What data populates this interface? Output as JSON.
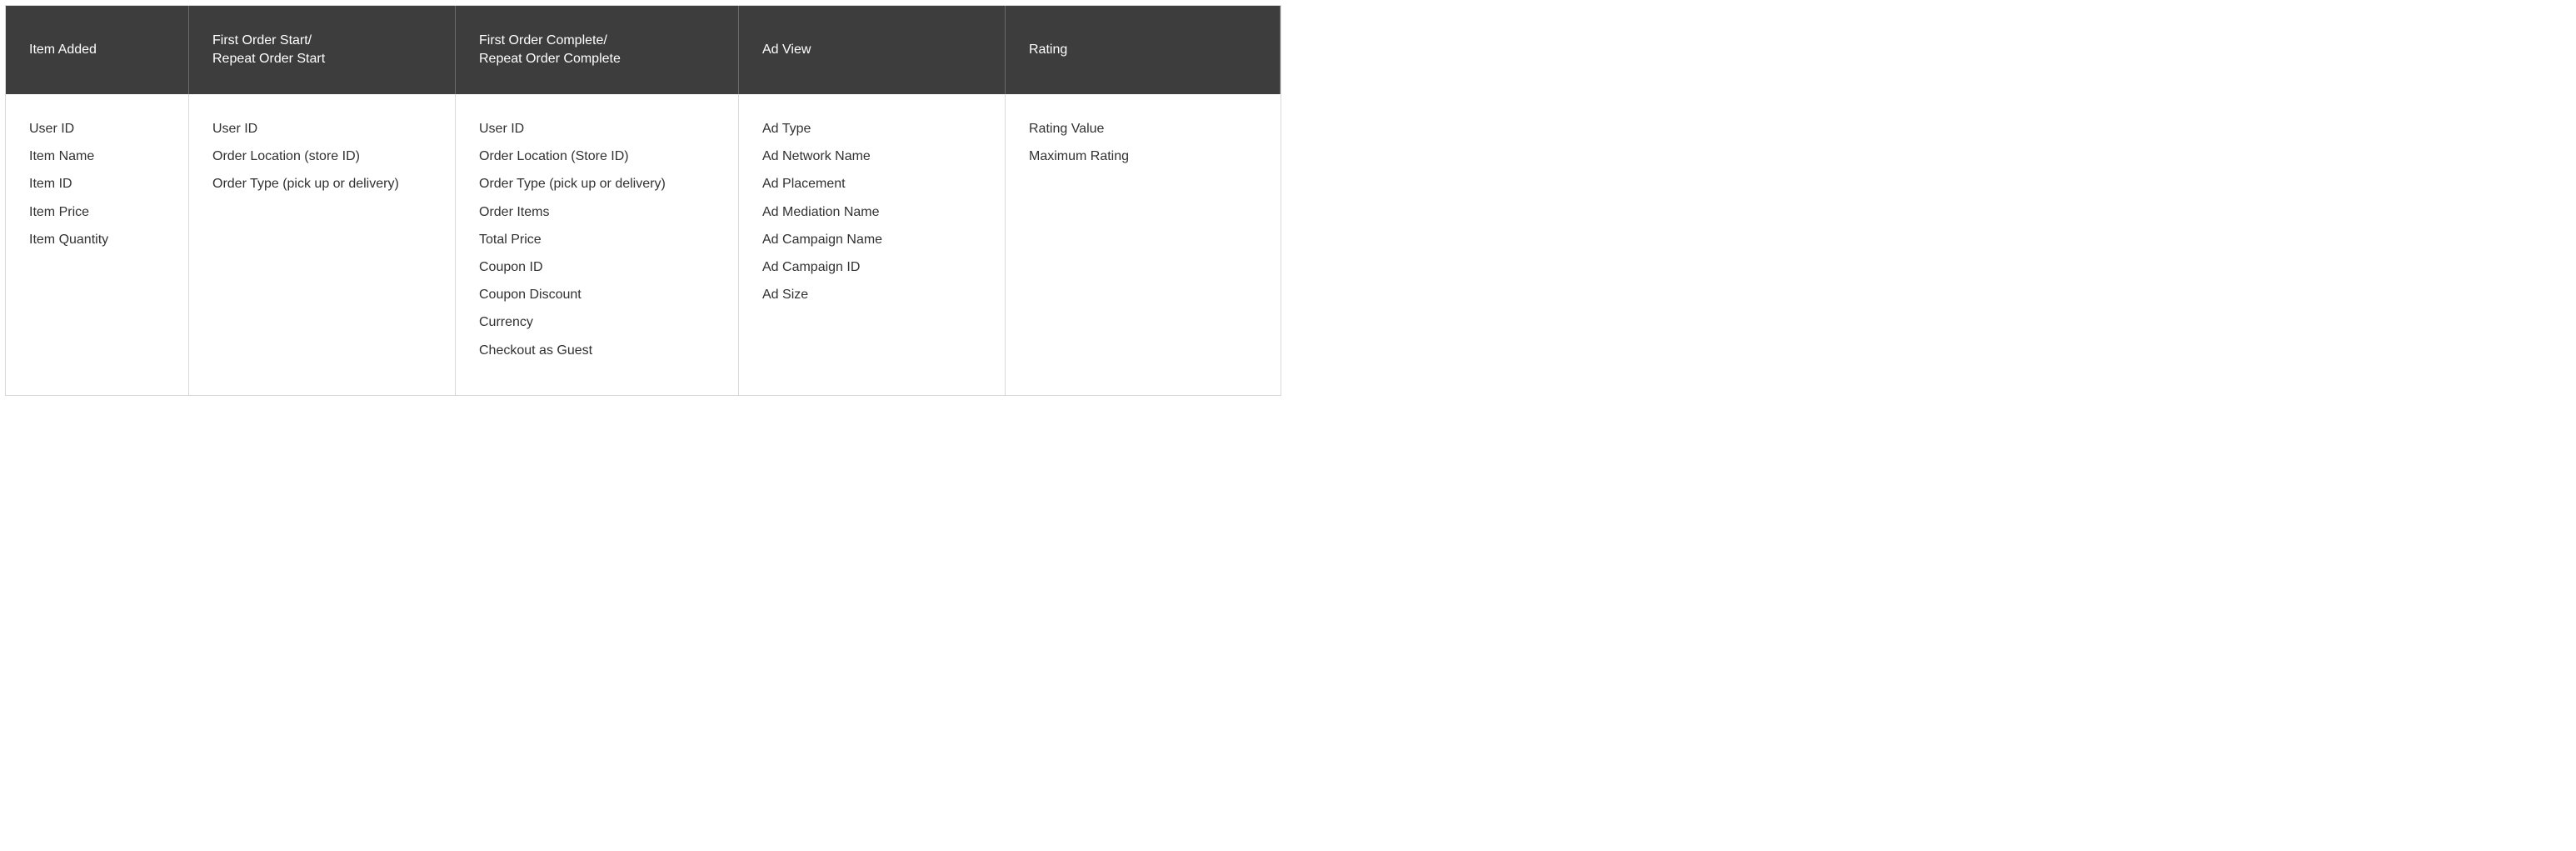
{
  "columns": [
    {
      "header_lines": [
        "Item Added"
      ],
      "items": [
        "User ID",
        "Item Name",
        "Item ID",
        "Item Price",
        "Item Quantity"
      ]
    },
    {
      "header_lines": [
        "First Order Start/",
        "Repeat Order Start"
      ],
      "items": [
        "User ID",
        "Order Location (store ID)",
        "Order Type (pick up or delivery)"
      ]
    },
    {
      "header_lines": [
        "First Order Complete/",
        "Repeat Order Complete"
      ],
      "items": [
        "User ID",
        "Order Location (Store ID)",
        "Order Type (pick up or delivery)",
        "Order Items",
        "Total Price",
        "Coupon ID",
        "Coupon Discount",
        "Currency",
        "Checkout as Guest"
      ]
    },
    {
      "header_lines": [
        "Ad View"
      ],
      "items": [
        "Ad Type",
        "Ad Network Name",
        "Ad Placement",
        "Ad Mediation Name",
        "Ad Campaign Name",
        "Ad Campaign ID",
        "Ad Size"
      ]
    },
    {
      "header_lines": [
        "Rating"
      ],
      "items": [
        "Rating Value",
        "Maximum Rating"
      ]
    }
  ]
}
